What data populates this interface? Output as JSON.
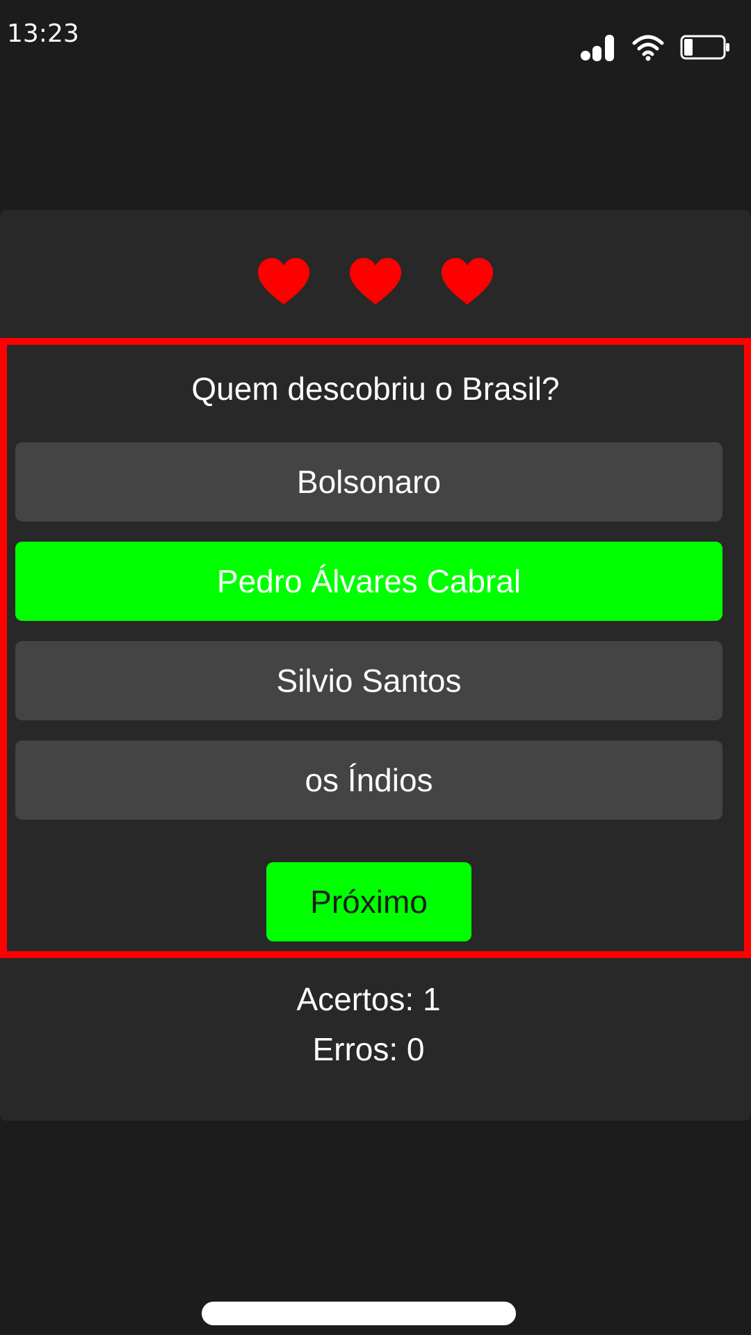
{
  "status_bar": {
    "time": "13:23",
    "icons": [
      "signal-icon",
      "wifi-icon",
      "battery-icon"
    ]
  },
  "lives": {
    "count": 3,
    "icon": "heart-icon",
    "color": "#ff0000"
  },
  "quiz": {
    "question": "Quem descobriu o Brasil?",
    "options": [
      {
        "label": "Bolsonaro",
        "state": "default"
      },
      {
        "label": "Pedro Álvares Cabral",
        "state": "correct"
      },
      {
        "label": "Silvio Santos",
        "state": "default"
      },
      {
        "label": "os Índios",
        "state": "default"
      }
    ],
    "next_label": "Próximo",
    "highlight_color": "#ff0000",
    "correct_color": "#00ff00"
  },
  "score": {
    "correct_text": "Acertos: 1",
    "errors_text": "Erros: 0"
  }
}
